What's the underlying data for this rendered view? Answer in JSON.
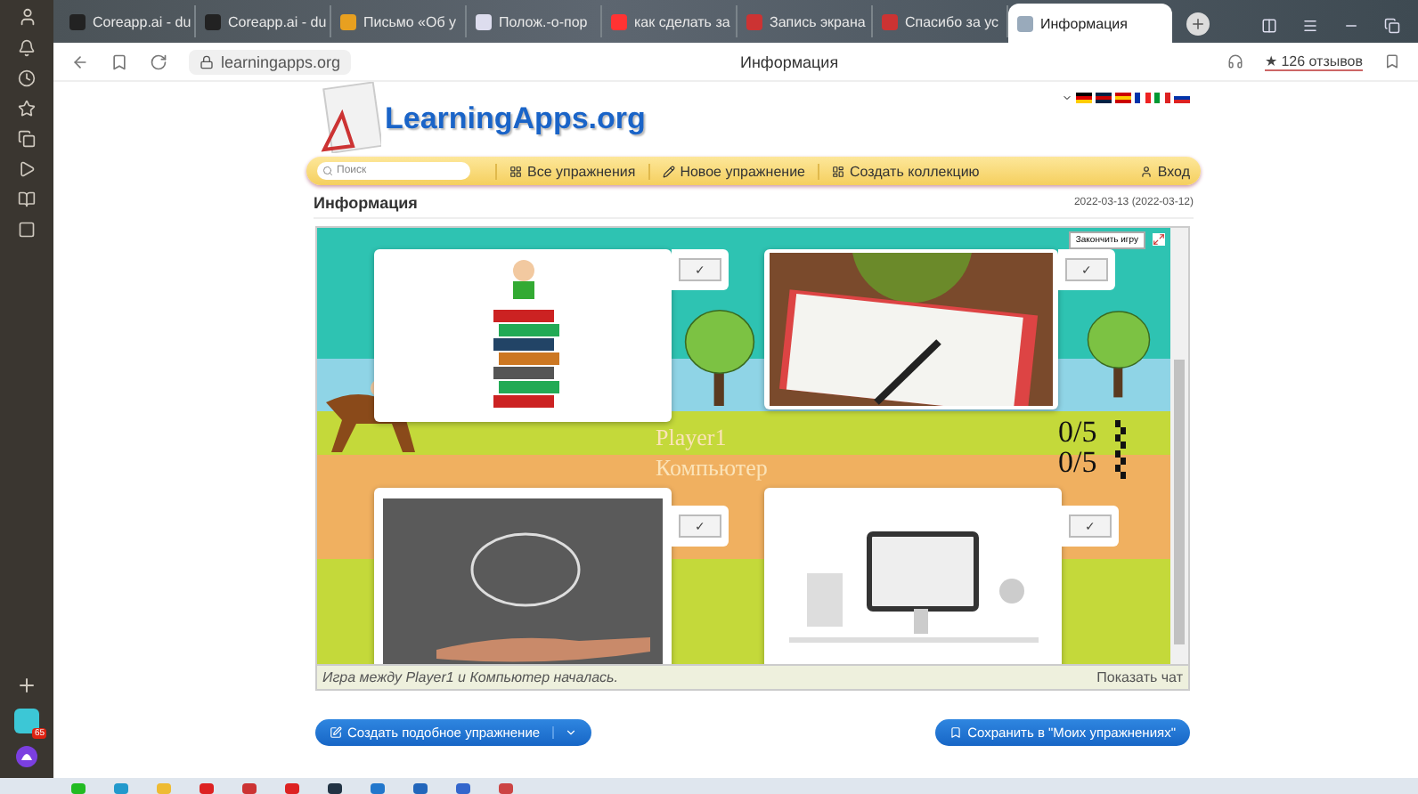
{
  "browser": {
    "tabs": [
      {
        "label": "Coreapp.ai - du",
        "kind": "dark",
        "selected": false
      },
      {
        "label": "Coreapp.ai - du",
        "kind": "dark",
        "selected": false
      },
      {
        "label": "Письмо «Об у",
        "kind": "mail",
        "selected": false
      },
      {
        "label": "Полож.-о-пор",
        "kind": "doc",
        "selected": false
      },
      {
        "label": "как сделать за",
        "kind": "yandex",
        "selected": false
      },
      {
        "label": "Запись экрана",
        "kind": "record",
        "selected": false
      },
      {
        "label": "Спасибо за ус",
        "kind": "record",
        "selected": false
      },
      {
        "label": "Информация",
        "kind": "page",
        "selected": true
      }
    ],
    "address": "learningapps.org",
    "page_title": "Информация",
    "reviews": "★ 126 отзывов",
    "sidebar_badge": "65"
  },
  "site": {
    "logo": "LearningApps.org",
    "search": {
      "placeholder": "Поиск"
    },
    "nav": [
      {
        "label": "Все упражнения",
        "kind": "grid"
      },
      {
        "label": "Новое упражнение",
        "kind": "pencil"
      },
      {
        "label": "Создать коллекцию",
        "kind": "collection"
      }
    ],
    "login": "Вход",
    "heading": "Информация",
    "date": "2022-03-13",
    "date_note": "(2022-03-12)",
    "game": {
      "end_button": "Закончить игру",
      "players": [
        {
          "name": "Player1",
          "score": "0/5"
        },
        {
          "name": "Компьютер",
          "score": "0/5"
        }
      ],
      "cards": [
        {
          "kind": "books",
          "check": "✓"
        },
        {
          "kind": "notebook",
          "check": "✓"
        },
        {
          "kind": "brain",
          "check": "✓"
        },
        {
          "kind": "computer",
          "check": "✓"
        }
      ],
      "status": "Игра между Player1 и Компьютер началась.",
      "chat": "Показать чат"
    },
    "buttons": {
      "create": "Создать подобное упражнение",
      "save": "Сохранить в \"Моих упражнениях\""
    }
  }
}
